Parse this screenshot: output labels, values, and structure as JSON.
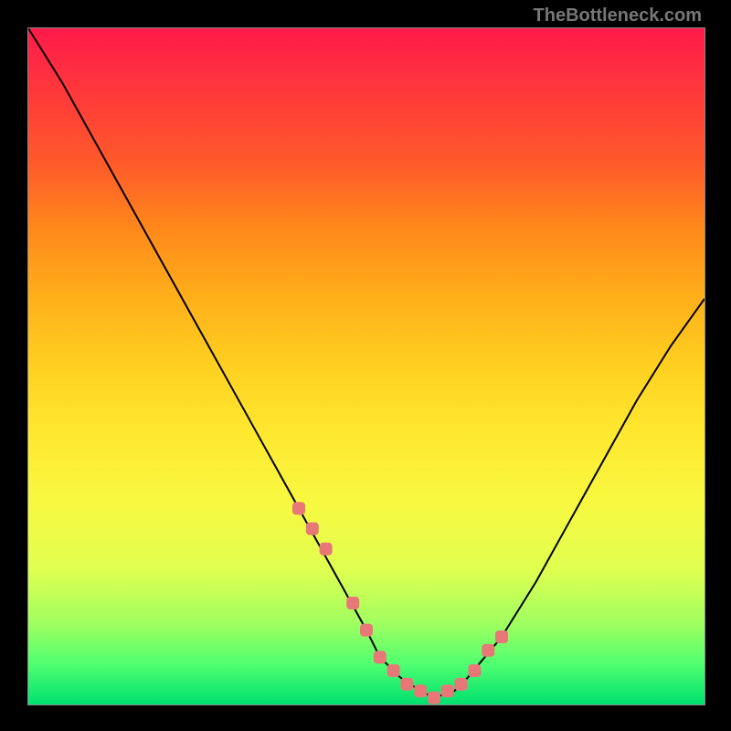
{
  "watermark": "TheBottleneck.com",
  "chart_data": {
    "type": "line",
    "title": "",
    "xlabel": "",
    "ylabel": "",
    "xlim": [
      0,
      100
    ],
    "ylim": [
      0,
      100
    ],
    "series": [
      {
        "name": "bottleneck-curve",
        "x": [
          0,
          5,
          10,
          15,
          20,
          25,
          30,
          35,
          40,
          45,
          50,
          52,
          55,
          58,
          60,
          63,
          65,
          70,
          75,
          80,
          85,
          90,
          95,
          100
        ],
        "y": [
          100,
          92,
          83,
          74,
          65,
          56,
          47,
          38,
          29,
          20,
          11,
          7,
          4,
          2,
          1,
          2,
          4,
          10,
          18,
          27,
          36,
          45,
          53,
          60
        ]
      }
    ],
    "markers": {
      "name": "highlighted-points",
      "color": "#e87878",
      "x": [
        40,
        42,
        44,
        48,
        50,
        52,
        54,
        56,
        58,
        60,
        62,
        64,
        66,
        68,
        70
      ],
      "y": [
        29,
        26,
        23,
        15,
        11,
        7,
        5,
        3,
        2,
        1,
        2,
        3,
        5,
        8,
        10
      ]
    },
    "gradient_stops": [
      {
        "pos": 0,
        "color": "#ff1a4a"
      },
      {
        "pos": 50,
        "color": "#ffe830"
      },
      {
        "pos": 100,
        "color": "#00e070"
      }
    ]
  }
}
